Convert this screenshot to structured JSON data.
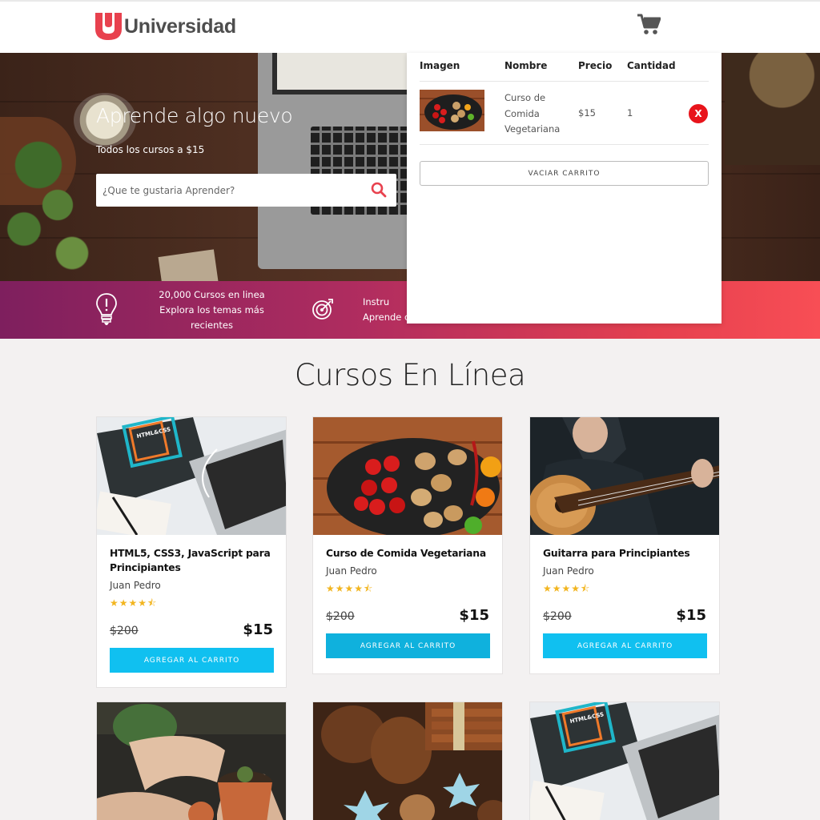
{
  "brand": {
    "name": "Universidad",
    "color": "#e8414e"
  },
  "hero": {
    "title": "Aprende algo nuevo",
    "subtitle": "Todos los cursos a $15",
    "search_placeholder": "¿Que te gustaria Aprender?"
  },
  "banner": {
    "item1_line1": "20,000 Cursos en linea",
    "item1_line2": "Explora los temas más recientes",
    "item2_line1": "Instru",
    "item2_line2": "Aprende c"
  },
  "cart": {
    "headers": {
      "image": "Imagen",
      "name": "Nombre",
      "price": "Precio",
      "qty": "Cantidad"
    },
    "items": [
      {
        "name": "Curso de Comida Vegetariana",
        "price": "$15",
        "qty": "1",
        "remove": "X"
      }
    ],
    "empty_label": "VACIAR CARRITO"
  },
  "section_title": "Cursos En Línea",
  "courses": [
    {
      "title": "HTML5, CSS3, JavaScript para Principiantes",
      "author": "Juan Pedro",
      "rating": 4.5,
      "stars": "★★★★⯪",
      "old_price": "$200",
      "price": "$15",
      "button": "AGREGAR AL CARRITO"
    },
    {
      "title": "Curso de Comida Vegetariana",
      "author": "Juan Pedro",
      "rating": 4.5,
      "stars": "★★★★⯪",
      "old_price": "$200",
      "price": "$15",
      "button": "AGREGAR AL CARRITO"
    },
    {
      "title": "Guitarra para Principiantes",
      "author": "Juan Pedro",
      "rating": 4.5,
      "stars": "★★★★⯪",
      "old_price": "$200",
      "price": "$15",
      "button": "AGREGAR AL CARRITO"
    }
  ],
  "image_labels": {
    "html_book": "HTML&CSS"
  },
  "colors": {
    "accent": "#10c0f0",
    "banner_start": "#7e1f5e",
    "banner_end": "#f84e55",
    "remove": "#e8141b",
    "star": "#f2b51f"
  }
}
